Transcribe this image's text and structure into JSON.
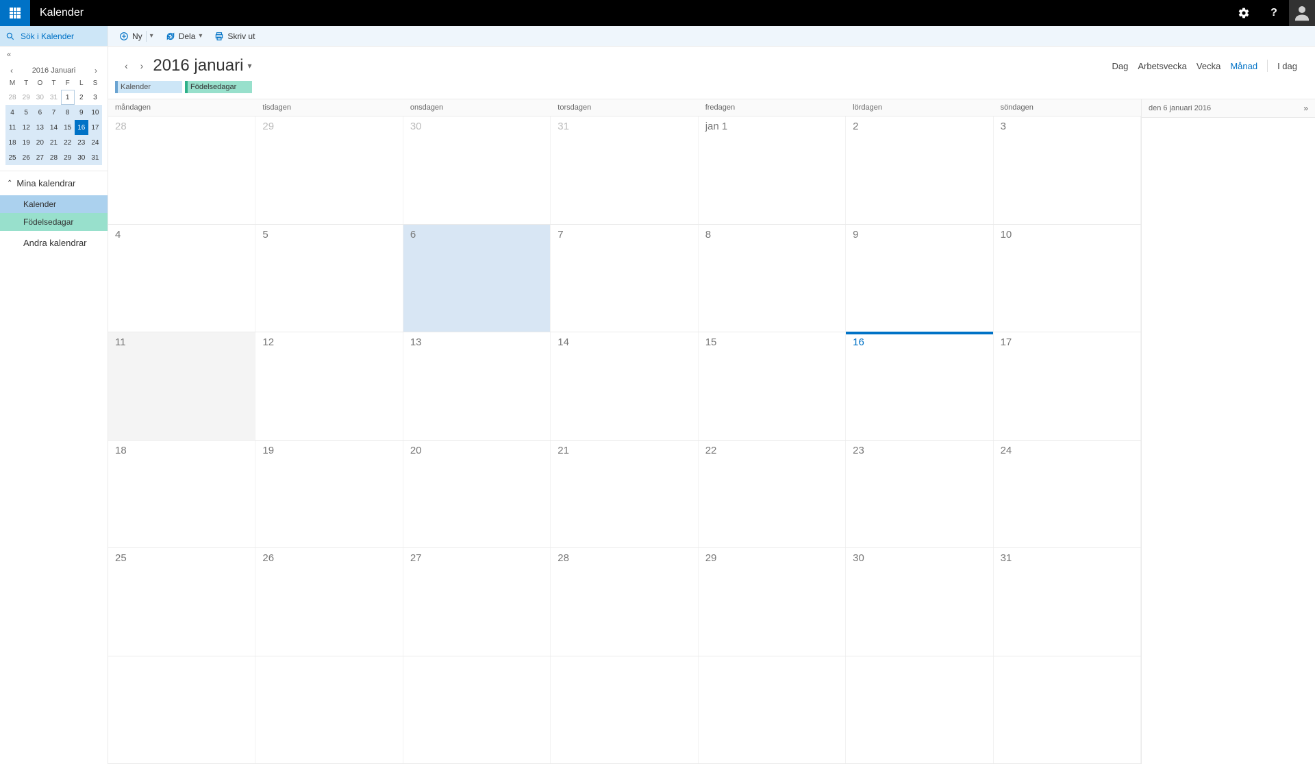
{
  "header": {
    "app_title": "Kalender"
  },
  "search": {
    "placeholder": "Sök i Kalender"
  },
  "commands": {
    "new": "Ny",
    "share": "Dela",
    "print": "Skriv ut"
  },
  "mini_calendar": {
    "title": "2016 Januari",
    "dow": [
      "M",
      "T",
      "O",
      "T",
      "F",
      "L",
      "S"
    ],
    "weeks": [
      {
        "hl": false,
        "days": [
          {
            "n": "28",
            "other": true
          },
          {
            "n": "29",
            "other": true
          },
          {
            "n": "30",
            "other": true
          },
          {
            "n": "31",
            "other": true
          },
          {
            "n": "1",
            "outline": true
          },
          {
            "n": "2"
          },
          {
            "n": "3"
          }
        ]
      },
      {
        "hl": true,
        "days": [
          {
            "n": "4"
          },
          {
            "n": "5"
          },
          {
            "n": "6"
          },
          {
            "n": "7"
          },
          {
            "n": "8"
          },
          {
            "n": "9"
          },
          {
            "n": "10"
          }
        ]
      },
      {
        "hl": true,
        "days": [
          {
            "n": "11"
          },
          {
            "n": "12"
          },
          {
            "n": "13"
          },
          {
            "n": "14"
          },
          {
            "n": "15"
          },
          {
            "n": "16",
            "today": true
          },
          {
            "n": "17"
          }
        ]
      },
      {
        "hl": true,
        "days": [
          {
            "n": "18"
          },
          {
            "n": "19"
          },
          {
            "n": "20"
          },
          {
            "n": "21"
          },
          {
            "n": "22"
          },
          {
            "n": "23"
          },
          {
            "n": "24"
          }
        ]
      },
      {
        "hl": true,
        "days": [
          {
            "n": "25"
          },
          {
            "n": "26"
          },
          {
            "n": "27"
          },
          {
            "n": "28"
          },
          {
            "n": "29"
          },
          {
            "n": "30"
          },
          {
            "n": "31"
          }
        ]
      }
    ]
  },
  "calendar_list": {
    "section_my": "Mina kalendrar",
    "items": [
      {
        "label": "Kalender",
        "cls": "kal"
      },
      {
        "label": "Födelsedagar",
        "cls": "fod"
      }
    ],
    "section_other": "Andra kalendrar"
  },
  "main": {
    "month_title": "2016 januari",
    "views": {
      "day": "Dag",
      "workweek": "Arbetsvecka",
      "week": "Vecka",
      "month": "Månad",
      "today": "I dag"
    },
    "chips": [
      {
        "label": "Kalender",
        "cls": "kal"
      },
      {
        "label": "Födelsedagar",
        "cls": "fod"
      }
    ],
    "dow": [
      "måndagen",
      "tisdagen",
      "onsdagen",
      "torsdagen",
      "fredagen",
      "lördagen",
      "söndagen"
    ],
    "weeks": [
      [
        {
          "n": "28",
          "other": true
        },
        {
          "n": "29",
          "other": true
        },
        {
          "n": "30",
          "other": true
        },
        {
          "n": "31",
          "other": true
        },
        {
          "n": "jan 1",
          "mlabel": true
        },
        {
          "n": "2"
        },
        {
          "n": "3"
        }
      ],
      [
        {
          "n": "4"
        },
        {
          "n": "5"
        },
        {
          "n": "6",
          "sel": true
        },
        {
          "n": "7"
        },
        {
          "n": "8"
        },
        {
          "n": "9"
        },
        {
          "n": "10"
        }
      ],
      [
        {
          "n": "11",
          "shade": true
        },
        {
          "n": "12"
        },
        {
          "n": "13"
        },
        {
          "n": "14"
        },
        {
          "n": "15"
        },
        {
          "n": "16",
          "today": true
        },
        {
          "n": "17"
        }
      ],
      [
        {
          "n": "18"
        },
        {
          "n": "19"
        },
        {
          "n": "20"
        },
        {
          "n": "21"
        },
        {
          "n": "22"
        },
        {
          "n": "23"
        },
        {
          "n": "24"
        }
      ],
      [
        {
          "n": "25"
        },
        {
          "n": "26"
        },
        {
          "n": "27"
        },
        {
          "n": "28"
        },
        {
          "n": "29"
        },
        {
          "n": "30"
        },
        {
          "n": "31"
        }
      ],
      [
        {
          "n": "",
          "other": true
        },
        {
          "n": "",
          "other": true
        },
        {
          "n": "",
          "other": true
        },
        {
          "n": "",
          "other": true
        },
        {
          "n": "",
          "other": true
        },
        {
          "n": "",
          "other": true
        },
        {
          "n": "",
          "other": true
        }
      ]
    ]
  },
  "agenda": {
    "date_label": "den 6 januari 2016"
  }
}
